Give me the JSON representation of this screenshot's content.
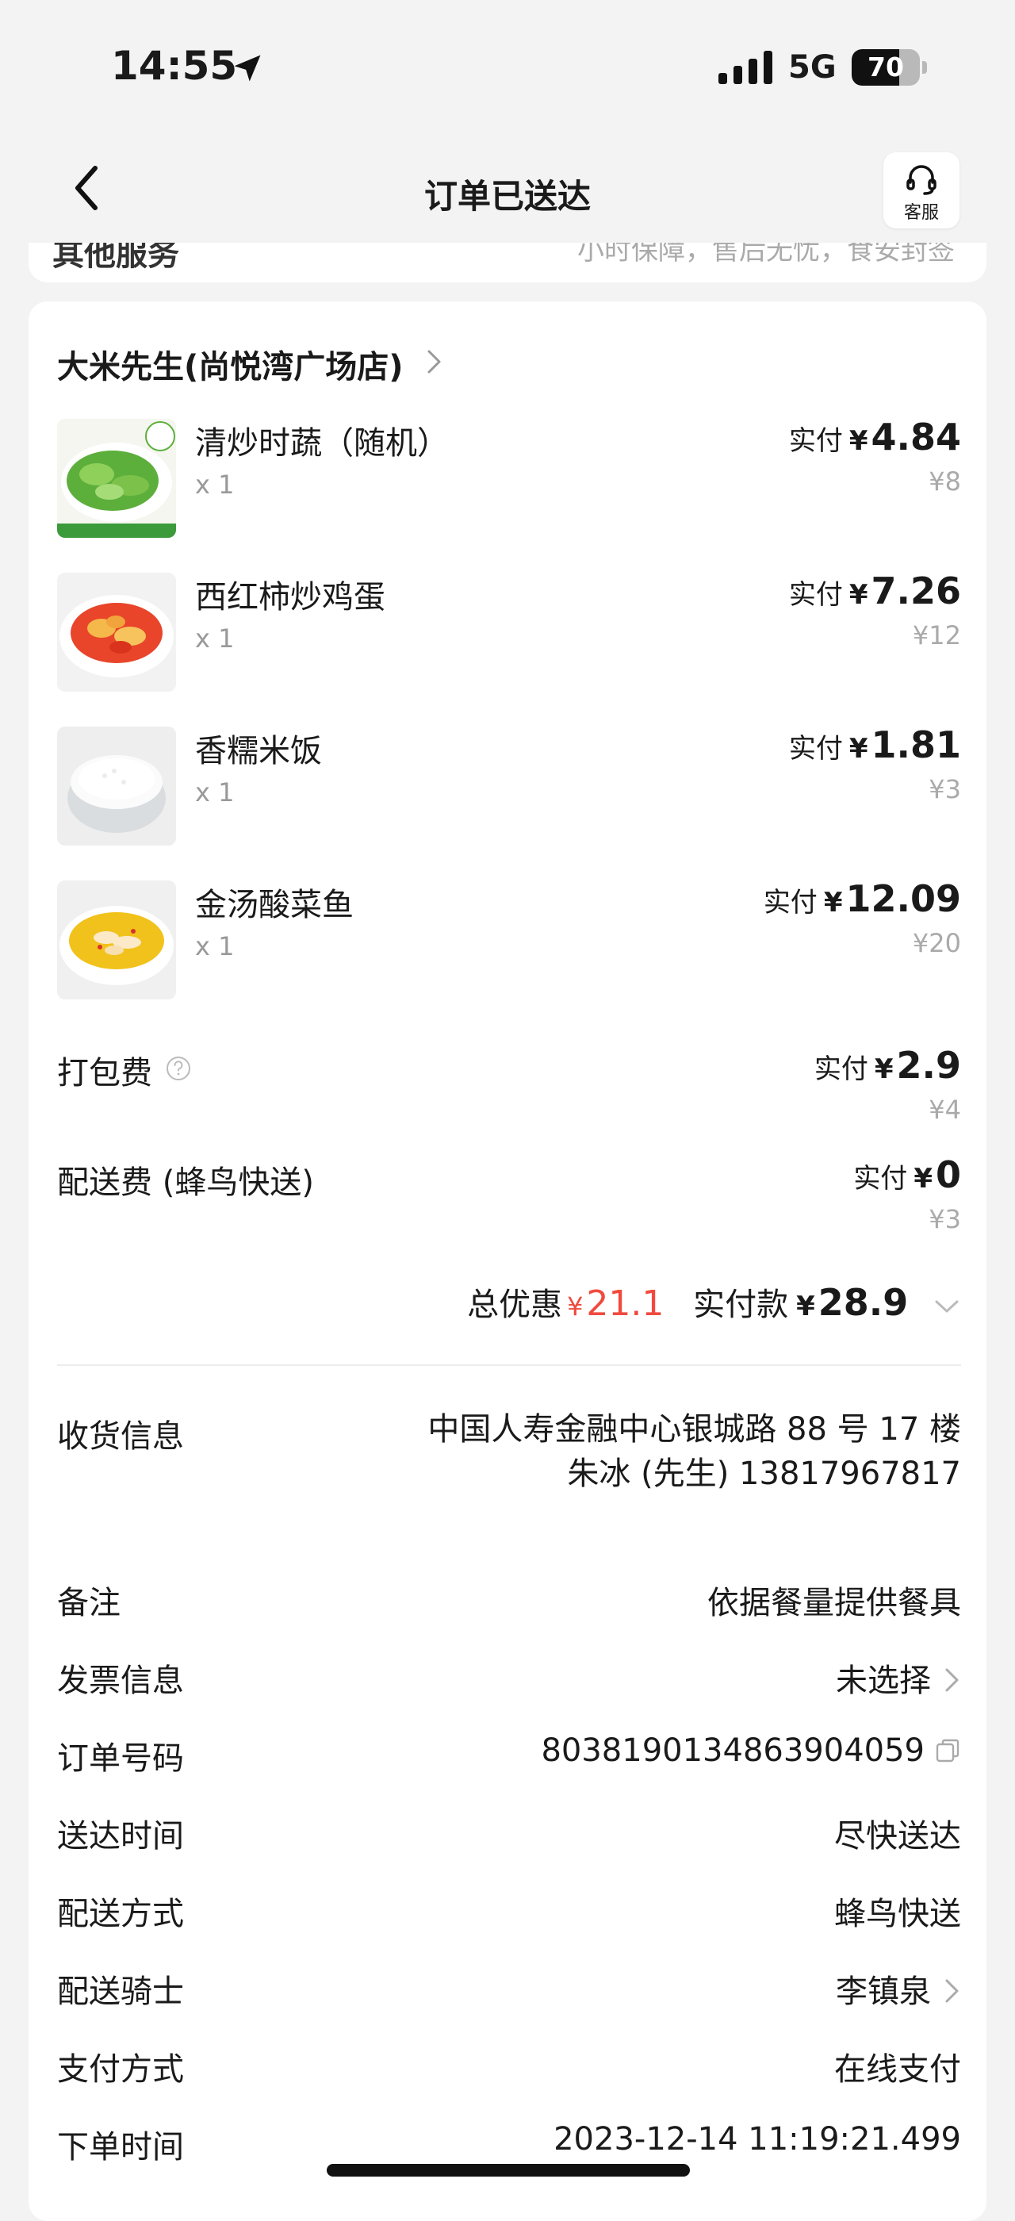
{
  "status_bar": {
    "time": "14:55",
    "network": "5G",
    "battery": "70",
    "battery_level": 0.7
  },
  "nav": {
    "title": "订单已送达",
    "service_label": "客服"
  },
  "peek": {
    "left": "其他服务",
    "right": "小时保障，售后无忧，食安封签"
  },
  "shop": {
    "name": "大米先生(尚悦湾广场店)"
  },
  "items": [
    {
      "name": "清炒时蔬（随机）",
      "qty": "x 1",
      "paid_label": "实付",
      "paid_yen": "¥",
      "paid_amount": "4.84",
      "original": "¥8"
    },
    {
      "name": "西红柿炒鸡蛋",
      "qty": "x 1",
      "paid_label": "实付",
      "paid_yen": "¥",
      "paid_amount": "7.26",
      "original": "¥12"
    },
    {
      "name": "香糯米饭",
      "qty": "x 1",
      "paid_label": "实付",
      "paid_yen": "¥",
      "paid_amount": "1.81",
      "original": "¥3"
    },
    {
      "name": "金汤酸菜鱼",
      "qty": "x 1",
      "paid_label": "实付",
      "paid_yen": "¥",
      "paid_amount": "12.09",
      "original": "¥20"
    }
  ],
  "fees": {
    "packaging": {
      "label": "打包费",
      "paid_label": "实付",
      "paid_yen": "¥",
      "paid_amount": "2.9",
      "original": "¥4"
    },
    "delivery": {
      "label": "配送费 (蜂鸟快送)",
      "paid_label": "实付",
      "paid_yen": "¥",
      "paid_amount": "0",
      "original": "¥3"
    }
  },
  "totals": {
    "discount_label": "总优惠",
    "discount_yen": "¥",
    "discount_amount": "21.1",
    "paid_label": "实付款",
    "paid_yen": "¥",
    "paid_amount": "28.9"
  },
  "info": {
    "address": {
      "label": "收货信息",
      "line1": "中国人寿金融中心银城路 88 号 17 楼",
      "line2": "朱冰 (先生) 13817967817"
    },
    "remark": {
      "label": "备注",
      "value": "依据餐量提供餐具"
    },
    "invoice": {
      "label": "发票信息",
      "value": "未选择"
    },
    "order_no": {
      "label": "订单号码",
      "value": "8038190134863904059"
    },
    "delivery_time": {
      "label": "送达时间",
      "value": "尽快送达"
    },
    "delivery_method": {
      "label": "配送方式",
      "value": "蜂鸟快送"
    },
    "rider": {
      "label": "配送骑士",
      "value": "李镇泉"
    },
    "payment": {
      "label": "支付方式",
      "value": "在线支付"
    },
    "order_time": {
      "label": "下单时间",
      "value": "2023-12-14 11:19:21.499"
    }
  },
  "colors": {
    "discount": "#f04a3e",
    "background": "#f3f3f3",
    "card": "#ffffff"
  }
}
